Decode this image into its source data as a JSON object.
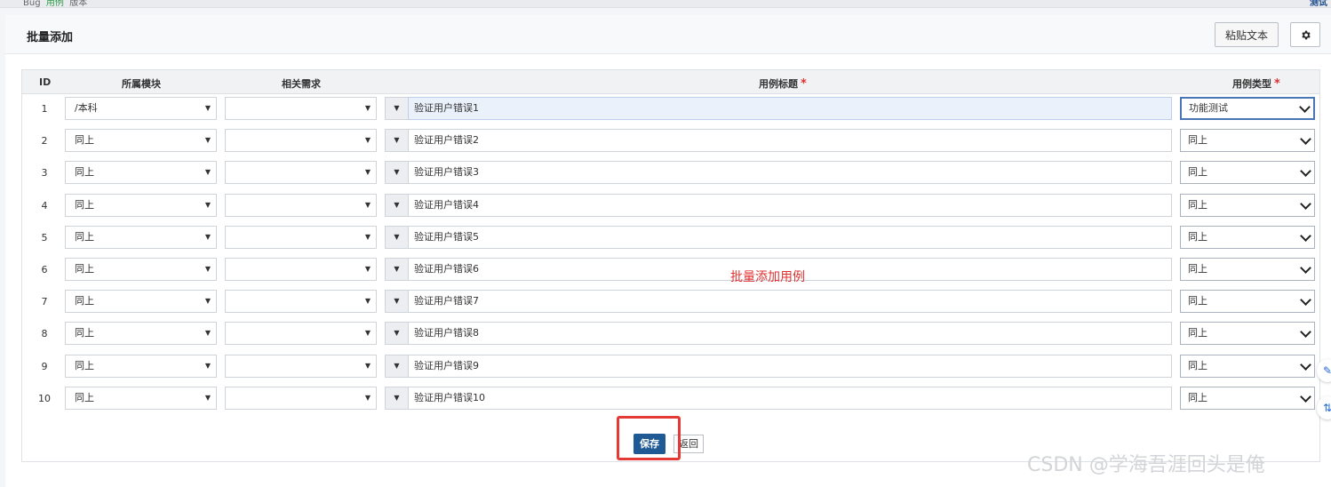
{
  "breadcrumb": {
    "left_text": "Bug",
    "highlight_text": "用例",
    "tail_text": "版本",
    "right_link": "测试"
  },
  "header": {
    "title": "批量添加",
    "paste_button": "粘贴文本",
    "settings_icon": "gear-icon"
  },
  "table": {
    "columns": {
      "id": "ID",
      "module": "所属模块",
      "story": "相关需求",
      "title": "用例标题",
      "type": "用例类型"
    },
    "required_mark": "*",
    "rows": [
      {
        "id": "1",
        "module": "/本科",
        "story": "",
        "title": "验证用户错误1",
        "type": "功能测试"
      },
      {
        "id": "2",
        "module": "同上",
        "story": "",
        "title": "验证用户错误2",
        "type": "同上"
      },
      {
        "id": "3",
        "module": "同上",
        "story": "",
        "title": "验证用户错误3",
        "type": "同上"
      },
      {
        "id": "4",
        "module": "同上",
        "story": "",
        "title": "验证用户错误4",
        "type": "同上"
      },
      {
        "id": "5",
        "module": "同上",
        "story": "",
        "title": "验证用户错误5",
        "type": "同上"
      },
      {
        "id": "6",
        "module": "同上",
        "story": "",
        "title": "验证用户错误6",
        "type": "同上"
      },
      {
        "id": "7",
        "module": "同上",
        "story": "",
        "title": "验证用户错误7",
        "type": "同上"
      },
      {
        "id": "8",
        "module": "同上",
        "story": "",
        "title": "验证用户错误8",
        "type": "同上"
      },
      {
        "id": "9",
        "module": "同上",
        "story": "",
        "title": "验证用户错误9",
        "type": "同上"
      },
      {
        "id": "10",
        "module": "同上",
        "story": "",
        "title": "验证用户错误10",
        "type": "同上"
      }
    ]
  },
  "annotation": "批量添加用例",
  "actions": {
    "save": "保存",
    "back": "返回"
  },
  "watermark": "CSDN @学海吾涯回头是俺",
  "floating": {
    "top_icon": "chat-icon",
    "bottom_icon": "sort-icon"
  }
}
